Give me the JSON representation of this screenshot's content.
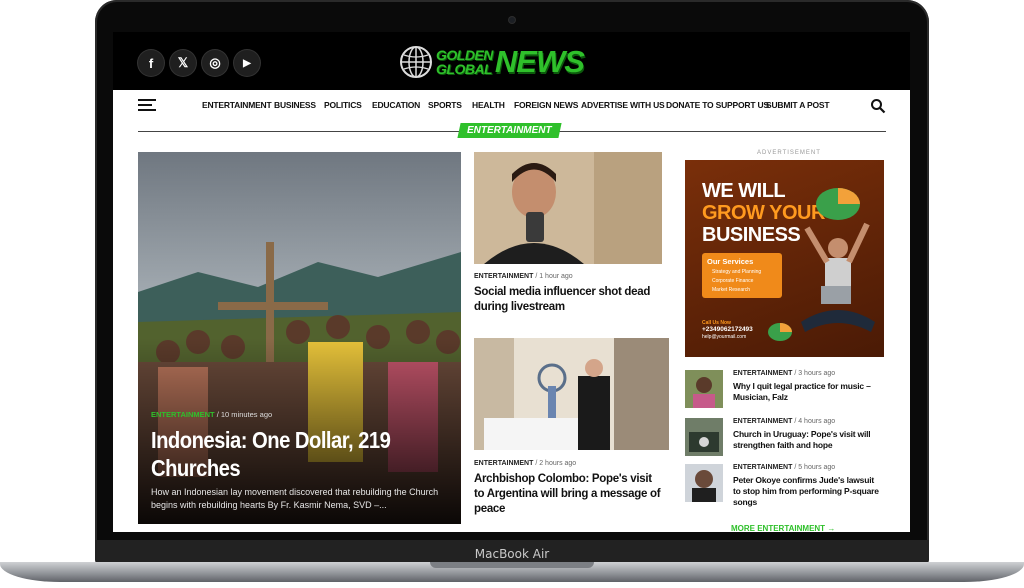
{
  "device": {
    "label": "MacBook Air"
  },
  "site": {
    "logo_small_line1": "GOLDEN",
    "logo_small_line2": "GLOBAL",
    "logo_big": "NEWS",
    "brand_color": "#2fc02b",
    "social": [
      {
        "icon": "facebook-icon",
        "glyph": "f"
      },
      {
        "icon": "x-icon",
        "glyph": "𝕏"
      },
      {
        "icon": "instagram-icon",
        "glyph": "◎"
      },
      {
        "icon": "youtube-icon",
        "glyph": "▶"
      }
    ]
  },
  "nav": {
    "items": [
      "ENTERTAINMENT",
      "BUSINESS",
      "POLITICS",
      "EDUCATION",
      "SPORTS",
      "HEALTH",
      "FOREIGN NEWS",
      "ADVERTISE WITH US",
      "DONATE TO SUPPORT US",
      "SUBMIT A POST"
    ]
  },
  "section": {
    "label": "ENTERTAINMENT"
  },
  "hero": {
    "category": "ENTERTAINMENT",
    "time": "10 minutes ago",
    "title": "Indonesia: One Dollar, 219 Churches",
    "excerpt": "How an Indonesian lay movement discovered that rebuilding the Church begins with rebuilding hearts By Fr. Kasmir Nema, SVD –..."
  },
  "middle": [
    {
      "category": "ENTERTAINMENT",
      "time": "1 hour ago",
      "title": "Social media influencer shot dead during livestream"
    },
    {
      "category": "ENTERTAINMENT",
      "time": "2 hours ago",
      "title": "Archbishop Colombo: Pope's visit to Argentina will bring a message of peace"
    }
  ],
  "ad": {
    "label": "ADVERTISEMENT",
    "line1": "WE WILL",
    "line2": "GROW YOUR",
    "line3": "BUSINESS",
    "box_title": "Our Services",
    "services": [
      "Strategy and Planning",
      "Corporate Finance",
      "Market Research"
    ],
    "call": "Call Us Now",
    "phone": "+2349062172493",
    "email": "help@yourmail.com"
  },
  "side": [
    {
      "category": "ENTERTAINMENT",
      "time": "3 hours ago",
      "title": "Why I quit legal practice for music – Musician, Falz"
    },
    {
      "category": "ENTERTAINMENT",
      "time": "4 hours ago",
      "title": "Church in Uruguay: Pope's visit will strengthen faith and hope"
    },
    {
      "category": "ENTERTAINMENT",
      "time": "5 hours ago",
      "title": "Peter Okoye confirms Jude's lawsuit to stop him from performing P-square songs"
    }
  ],
  "more": {
    "label": "MORE ENTERTAINMENT"
  }
}
